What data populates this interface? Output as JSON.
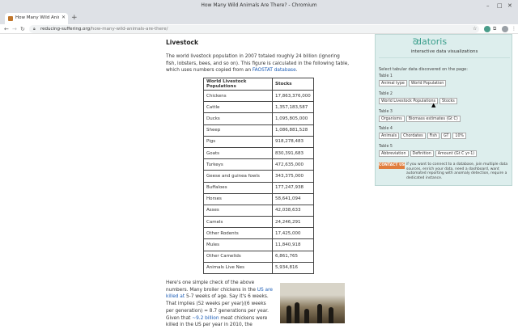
{
  "window": {
    "title": "How Many Wild Animals Are There? - Chromium"
  },
  "tabs": [
    {
      "title": "How Many Wild Animals A"
    }
  ],
  "address_bar": {
    "host": "reducing-suffering.org",
    "path": "/how-many-wild-animals-are-there/"
  },
  "article": {
    "heading": "Livestock",
    "intro_before_link": "The world livestock population in 2007 totaled roughly 24 billion (ignoring fish, lobsters, bees, and so on). This figure is calculated in the following table, which uses numbers copied from an ",
    "intro_link": "FAOSTAT database",
    "intro_after_link": ".",
    "table": {
      "headers": [
        "World Livestock Populations",
        "Stocks"
      ],
      "rows": [
        [
          "Chickens",
          "17,863,376,000"
        ],
        [
          "Cattle",
          "1,357,183,587"
        ],
        [
          "Ducks",
          "1,095,805,000"
        ],
        [
          "Sheep",
          "1,086,881,528"
        ],
        [
          "Pigs",
          "918,278,483"
        ],
        [
          "Goats",
          "830,391,683"
        ],
        [
          "Turkeys",
          "472,635,000"
        ],
        [
          "Geese and guinea fowls",
          "343,375,000"
        ],
        [
          "Buffaloes",
          "177,247,938"
        ],
        [
          "Horses",
          "58,641,094"
        ],
        [
          "Asses",
          "42,038,633"
        ],
        [
          "Camels",
          "24,246,291"
        ],
        [
          "Other Rodents",
          "17,425,000"
        ],
        [
          "Mules",
          "11,840,918"
        ],
        [
          "Other Camelids",
          "6,861,765"
        ],
        [
          "Animals Live Nes",
          "5,934,816"
        ]
      ]
    },
    "check": {
      "t1": "Here's one simple check of the above numbers. Many broiler chickens in the ",
      "l1": "US",
      "t2": " ",
      "l2": "are killed at",
      "t3": " 5-7 weeks of age. Say it's 6 weeks. That implies (52 weeks per year)/(6 weeks per generation) = 8.7 generations per year. Given that ",
      "l3": "~9.2 billion",
      "t4": " meat chickens were killed in the US per year in 2010, the"
    }
  },
  "extension": {
    "brand": "datoris",
    "tagline": "interactive data visualizations",
    "intro": "Select tabular data discovered on the page:",
    "tables": [
      {
        "label": "Table 1",
        "columns": [
          "Animal type",
          "World Population"
        ]
      },
      {
        "label": "Table 2",
        "columns": [
          "World Livestock Populations",
          "Stocks"
        ]
      },
      {
        "label": "Table 3",
        "columns": [
          "Organisms",
          "Biomass estimates (Gt C)"
        ]
      },
      {
        "label": "Table 4",
        "columns": [
          "Animals",
          "Chordates",
          "Fish",
          "GT",
          "10%"
        ]
      },
      {
        "label": "Table 5",
        "columns": [
          "Abbreviation",
          "Definition",
          "Amount (Gt C yr-1)"
        ]
      }
    ],
    "contact_button": "CONTACT US",
    "contact_text": "if you want to connect to a database, join multiple data sources, enrich your data, need a dashboard, want automated reporting with anomaly detection, require a dedicated instance."
  },
  "icons": {
    "back": "arrow-left",
    "forward": "arrow-right",
    "reload": "reload",
    "lock": "lock",
    "star": "star",
    "extension": "datoris-extension",
    "puzzle": "puzzle",
    "profile": "avatar",
    "menu": "kebab"
  }
}
